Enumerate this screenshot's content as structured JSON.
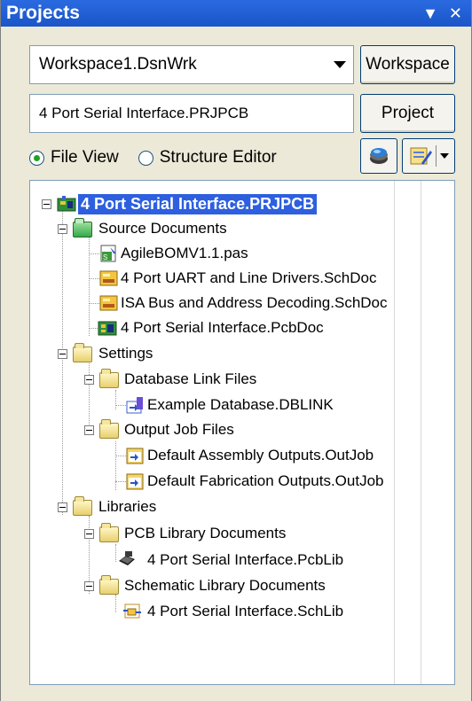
{
  "panel": {
    "title": "Projects",
    "pin_glyph": "▼",
    "close_glyph": "✕"
  },
  "workspace": {
    "selected": "Workspace1.DsnWrk",
    "button_label": "Workspace"
  },
  "project": {
    "current": "4 Port Serial Interface.PRJPCB",
    "button_label": "Project"
  },
  "view_mode": {
    "file_view_label": "File View",
    "structure_editor_label": "Structure Editor",
    "selected": "File View"
  },
  "tree": {
    "items": [
      {
        "label": "4 Port Serial Interface.PRJPCB",
        "icon": "pcb-project-icon",
        "level": 0,
        "expanded": true,
        "selected": true
      },
      {
        "label": "Source Documents",
        "icon": "folder-icon",
        "level": 1,
        "expanded": true
      },
      {
        "label": "AgileBOMV1.1.pas",
        "icon": "script-file-icon",
        "level": 2
      },
      {
        "label": "4 Port UART and Line Drivers.SchDoc",
        "icon": "schematic-doc-icon",
        "level": 2
      },
      {
        "label": "ISA Bus and Address Decoding.SchDoc",
        "icon": "schematic-doc-icon",
        "level": 2
      },
      {
        "label": "4 Port Serial Interface.PcbDoc",
        "icon": "pcb-doc-icon",
        "level": 2
      },
      {
        "label": "Settings",
        "icon": "folder-icon",
        "level": 1,
        "expanded": true
      },
      {
        "label": "Database Link Files",
        "icon": "folder-icon",
        "level": 2,
        "expanded": true
      },
      {
        "label": "Example Database.DBLINK",
        "icon": "dblink-file-icon",
        "level": 3
      },
      {
        "label": "Output Job Files",
        "icon": "folder-icon",
        "level": 2,
        "expanded": true
      },
      {
        "label": "Default Assembly Outputs.OutJob",
        "icon": "outjob-file-icon",
        "level": 3
      },
      {
        "label": "Default Fabrication Outputs.OutJob",
        "icon": "outjob-file-icon",
        "level": 3
      },
      {
        "label": "Libraries",
        "icon": "folder-icon",
        "level": 1,
        "expanded": true
      },
      {
        "label": "PCB Library Documents",
        "icon": "folder-icon",
        "level": 2,
        "expanded": true
      },
      {
        "label": "4 Port Serial Interface.PcbLib",
        "icon": "pcblib-file-icon",
        "level": 3
      },
      {
        "label": "Schematic Library Documents",
        "icon": "folder-icon",
        "level": 2,
        "expanded": true
      },
      {
        "label": "4 Port Serial Interface.SchLib",
        "icon": "schlib-file-icon",
        "level": 3
      }
    ]
  }
}
